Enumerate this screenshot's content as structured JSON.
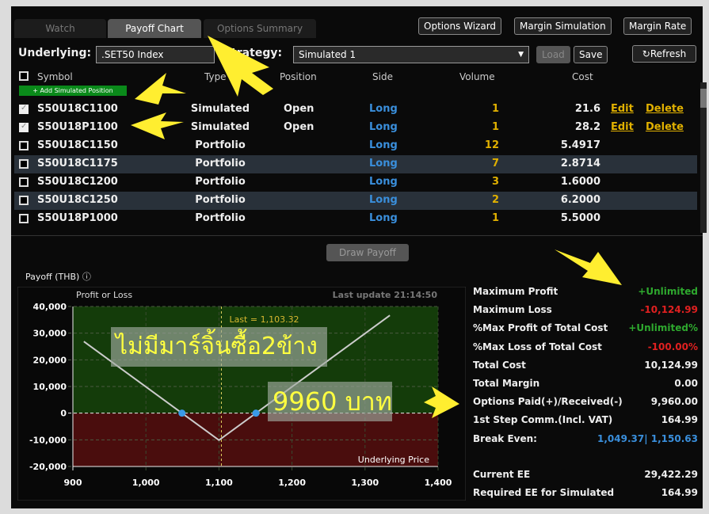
{
  "tabs": [
    {
      "label": "Watch",
      "active": false
    },
    {
      "label": "Payoff Chart",
      "active": true
    },
    {
      "label": "Options Summary",
      "active": false
    }
  ],
  "top_buttons": {
    "wizard": "Options Wizard",
    "margin_sim": "Margin Simulation",
    "margin_rate": "Margin Rate"
  },
  "toolbar": {
    "underlying_label": "Underlying:",
    "underlying_value": ".SET50 Index",
    "strategy_label": "Strategy:",
    "strategy_value": "Simulated 1",
    "load": "Load",
    "save": "Save",
    "refresh": "Refresh"
  },
  "table": {
    "headers": {
      "symbol": "Symbol",
      "type": "Type",
      "position": "Position",
      "side": "Side",
      "volume": "Volume",
      "cost": "Cost"
    },
    "add_button": "+ Add Simulated Position",
    "edit": "Edit",
    "delete": "Delete",
    "rows": [
      {
        "checked": true,
        "symbol": "S50U18C1100",
        "type": "Simulated",
        "position": "Open",
        "side": "Long",
        "volume": "1",
        "cost": "21.6",
        "editable": true
      },
      {
        "checked": true,
        "symbol": "S50U18P1100",
        "type": "Simulated",
        "position": "Open",
        "side": "Long",
        "volume": "1",
        "cost": "28.2",
        "editable": true
      },
      {
        "checked": false,
        "symbol": "S50U18C1150",
        "type": "Portfolio",
        "position": "",
        "side": "Long",
        "volume": "12",
        "cost": "5.4917"
      },
      {
        "checked": false,
        "symbol": "S50U18C1175",
        "type": "Portfolio",
        "position": "",
        "side": "Long",
        "volume": "7",
        "cost": "2.8714"
      },
      {
        "checked": false,
        "symbol": "S50U18C1200",
        "type": "Portfolio",
        "position": "",
        "side": "Long",
        "volume": "3",
        "cost": "1.6000"
      },
      {
        "checked": false,
        "symbol": "S50U18C1250",
        "type": "Portfolio",
        "position": "",
        "side": "Long",
        "volume": "2",
        "cost": "6.2000"
      },
      {
        "checked": false,
        "symbol": "S50U18P1000",
        "type": "Portfolio",
        "position": "",
        "side": "Long",
        "volume": "1",
        "cost": "5.5000"
      }
    ]
  },
  "draw_payoff": "Draw Payoff",
  "payoff_title": "Payoff (THB)",
  "chart_data": {
    "type": "line",
    "ylabel": "Profit or Loss",
    "xlabel": "Underlying Price",
    "last_update": "Last update 21:14:50",
    "last_label": "Last = 1,103.32",
    "last_value": 1103.32,
    "xlim": [
      900,
      1400
    ],
    "ylim": [
      -20000,
      40000
    ],
    "xticks": [
      "900",
      "1,000",
      "1,100",
      "1,200",
      "1,300",
      "1,400"
    ],
    "yticks": [
      "40,000",
      "30,000",
      "20,000",
      "10,000",
      "0",
      "-10,000",
      "-20,000"
    ],
    "x": [
      915,
      1100,
      1334
    ],
    "y": [
      26875,
      -10125,
      36675
    ],
    "break_even_points": [
      1049.37,
      1150.63
    ],
    "grid": true,
    "colors": {
      "profit_zone": "#143c0a",
      "loss_zone": "#4a0d0d",
      "line": "#cccccc",
      "points": "#3a9ae8"
    }
  },
  "annotations": {
    "note1": "ไม่มีมาร์จิ้นซื้อ2ข้าง",
    "note2": "9960 บาท"
  },
  "stats": [
    {
      "label": "Maximum Profit",
      "value": "+Unlimited",
      "color": "g"
    },
    {
      "label": "Maximum Loss",
      "value": "-10,124.99",
      "color": "r"
    },
    {
      "label": "%Max Profit of Total Cost",
      "value": "+Unlimited%",
      "color": "g"
    },
    {
      "label": "%Max Loss of Total Cost",
      "value": "-100.00%",
      "color": "r"
    },
    {
      "label": "Total Cost",
      "value": "10,124.99",
      "color": ""
    },
    {
      "label": "Total Margin",
      "value": "0.00",
      "color": ""
    },
    {
      "label": "Options Paid(+)/Received(-)",
      "value": "9,960.00",
      "color": ""
    },
    {
      "label": "1st Step Comm.(Incl. VAT)",
      "value": "164.99",
      "color": ""
    },
    {
      "label": "Break Even:",
      "value": "1,049.37| 1,150.63",
      "color": "b"
    },
    {
      "label": "Current EE",
      "value": "29,422.29",
      "color": ""
    },
    {
      "label": "Required EE for Simulated",
      "value": "164.99",
      "color": ""
    }
  ]
}
